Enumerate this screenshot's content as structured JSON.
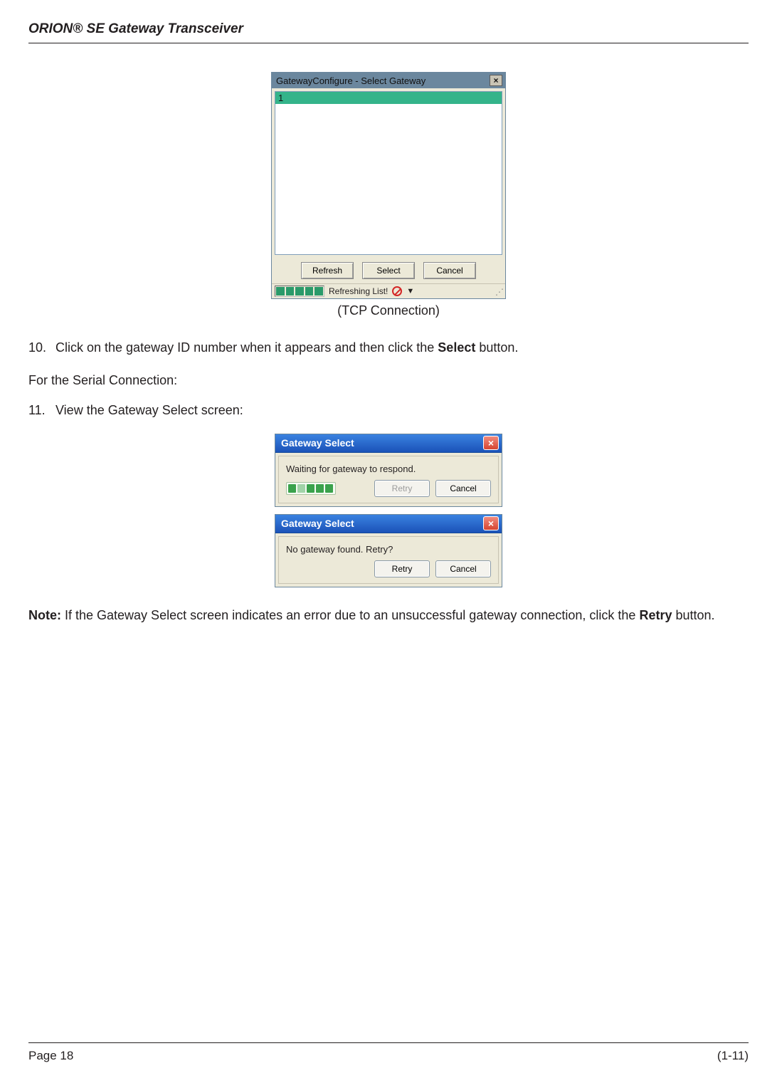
{
  "header": {
    "title": "ORION® SE Gateway Transceiver"
  },
  "figure1": {
    "titlebar": "GatewayConfigure - Select Gateway",
    "list_item": "1",
    "buttons": {
      "refresh": "Refresh",
      "select": "Select",
      "cancel": "Cancel"
    },
    "status": "Refreshing List!",
    "caption": "(TCP Connection)"
  },
  "steps": {
    "n10": "10.",
    "t10a": "Click on the gateway ID number when it appears and then click the ",
    "t10b": "Select",
    "t10c": " button.",
    "serial_intro": "For the Serial Connection:",
    "n11": "11.",
    "t11": "View the Gateway Select screen:"
  },
  "dlg_waiting": {
    "title": "Gateway Select",
    "msg": "Waiting for gateway to respond.",
    "retry": "Retry",
    "cancel": "Cancel"
  },
  "dlg_retry": {
    "title": "Gateway Select",
    "msg": "No gateway found. Retry?",
    "retry": "Retry",
    "cancel": "Cancel"
  },
  "note": {
    "label": "Note:",
    "a": "  If the Gateway Select screen indicates an error due to an unsuccessful gateway connection, click the ",
    "b": "Retry",
    "c": " button."
  },
  "footer": {
    "left": "Page 18",
    "right": "(1-11)"
  }
}
